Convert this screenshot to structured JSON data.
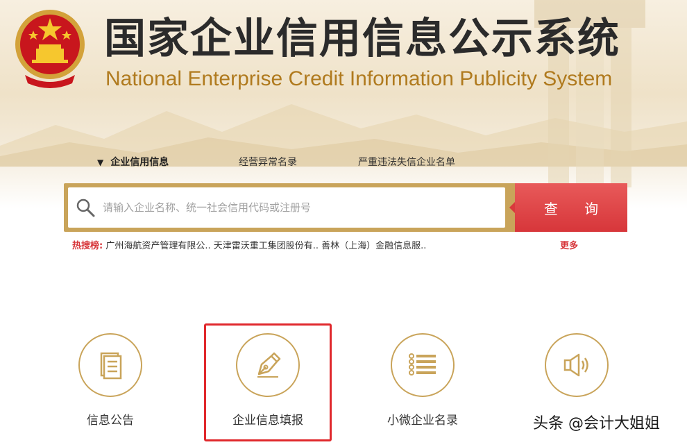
{
  "header": {
    "title_cn": "国家企业信用信息公示系统",
    "title_en": "National Enterprise Credit Information Publicity System"
  },
  "tabs": [
    {
      "label": "企业信用信息",
      "active": true
    },
    {
      "label": "经营异常名录",
      "active": false
    },
    {
      "label": "严重违法失信企业名单",
      "active": false
    }
  ],
  "search": {
    "placeholder": "请输入企业名称、统一社会信用代码或注册号",
    "button_label": "查 询"
  },
  "hot_search": {
    "label": "热搜榜:",
    "items": [
      "广州海航资产管理有限公..",
      "天津雷沃重工集团股份有..",
      "善林（上海）金融信息服.."
    ],
    "more_label": "更多"
  },
  "features": [
    {
      "label": "信息公告",
      "icon": "document-icon"
    },
    {
      "label": "企业信息填报",
      "icon": "pen-icon"
    },
    {
      "label": "小微企业名录",
      "icon": "list-icon"
    },
    {
      "label": "",
      "icon": "speaker-icon"
    }
  ],
  "watermark": "头条 @会计大姐姐",
  "colors": {
    "gold": "#c9a45a",
    "red": "#d7363a",
    "highlight": "#e0282c",
    "title_en": "#b07a1e"
  }
}
